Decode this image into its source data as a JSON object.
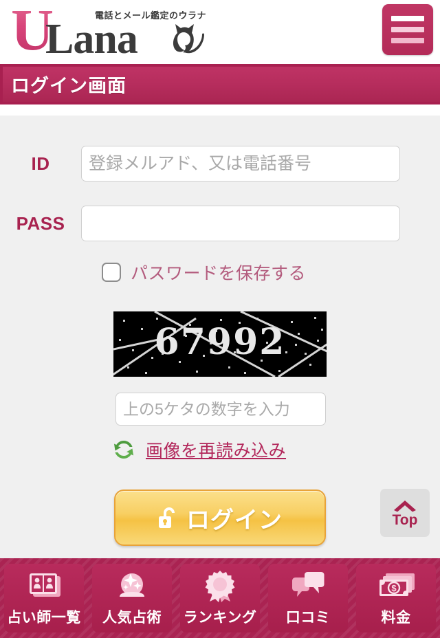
{
  "header": {
    "logo_u": "U",
    "logo_lana": "Lana",
    "tagline": "電話とメール鑑定のウラナ",
    "cat_icon": "cat-silhouette-icon",
    "menu_icon": "hamburger-menu-icon"
  },
  "page": {
    "title": "ログイン画面"
  },
  "form": {
    "id_label": "ID",
    "id_placeholder": "登録メルアド、又は電話番号",
    "id_value": "",
    "pass_label": "PASS",
    "pass_placeholder": "",
    "pass_value": "",
    "remember_label": "パスワードを保存する",
    "remember_checked": false,
    "captcha_code": "67992",
    "captcha_placeholder": "上の5ケタの数字を入力",
    "captcha_value": "",
    "reload_link": "画像を再読み込み",
    "reload_icon": "refresh-arrows-icon",
    "login_label": "ログイン",
    "login_icon": "open-padlock-icon"
  },
  "top_button": {
    "label": "Top",
    "icon": "chevron-up-icon"
  },
  "bottom_nav": [
    {
      "label": "占い師一覧",
      "icon": "fortune-teller-cards-icon"
    },
    {
      "label": "人気占術",
      "icon": "crystal-ball-icon"
    },
    {
      "label": "ランキング",
      "icon": "rosette-ribbon-icon"
    },
    {
      "label": "口コミ",
      "icon": "speech-bubbles-icon"
    },
    {
      "label": "料金",
      "icon": "banknotes-icon"
    }
  ],
  "colors": {
    "brand_crimson": "#a8224f",
    "titlebar": "#b62d5d",
    "logo_pink": "#d8447a",
    "login_button": "#f5c244",
    "reload_icon_green": "#4e9c3f",
    "form_bg": "#f0f0f0"
  }
}
